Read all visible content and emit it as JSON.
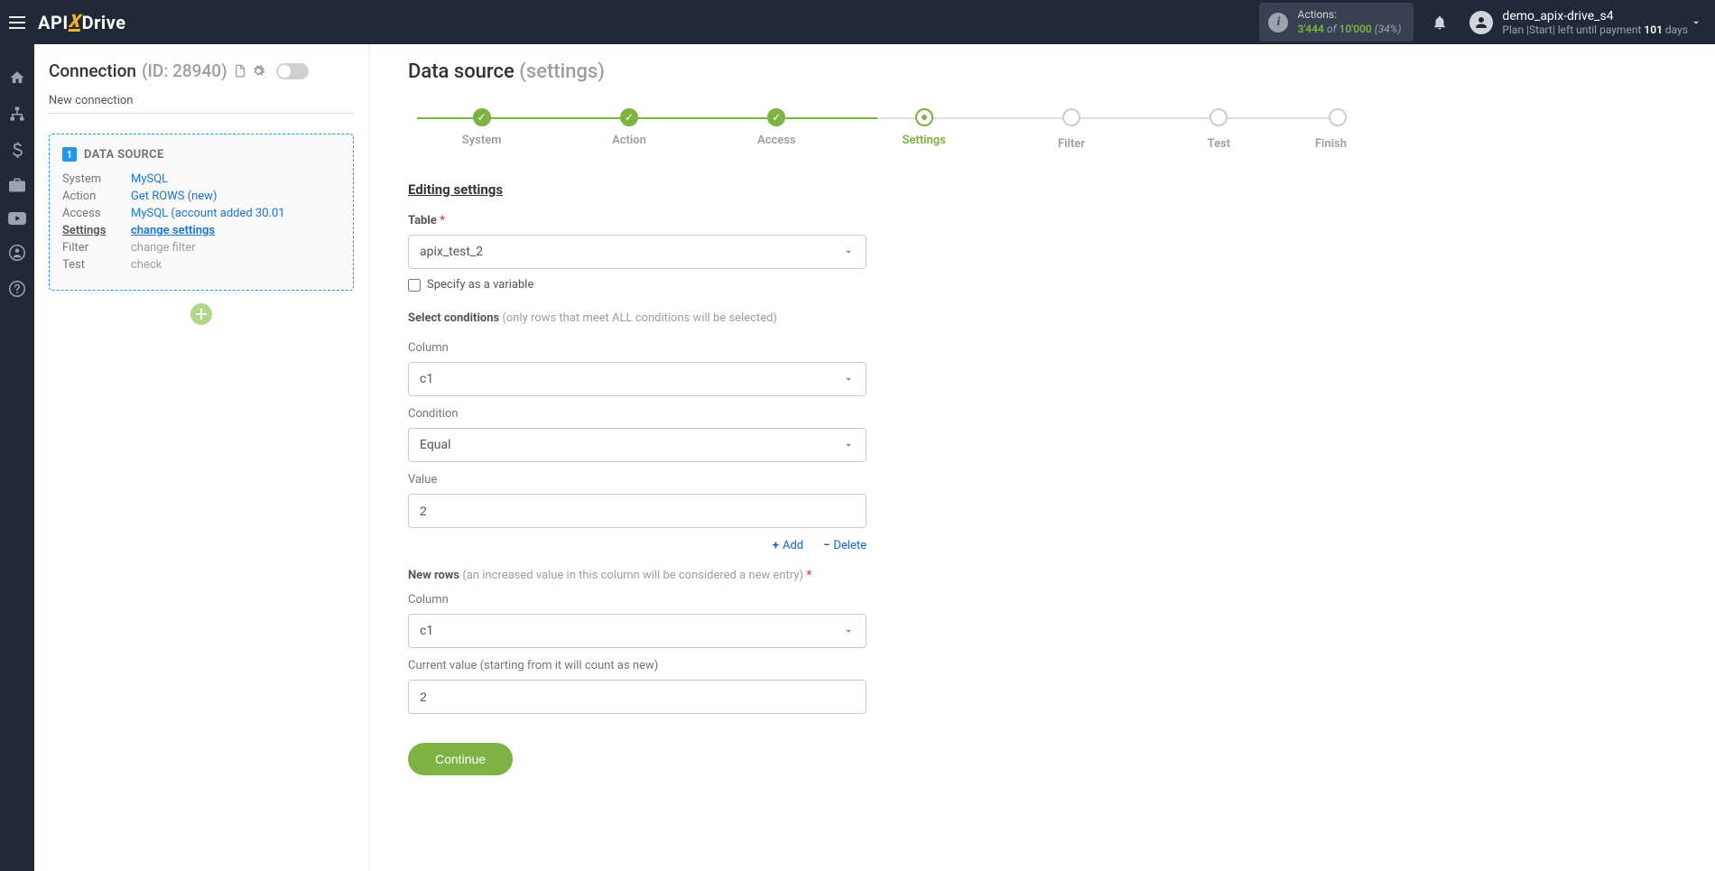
{
  "header": {
    "logo": {
      "part1": "API",
      "x": "X",
      "part2": "Drive"
    },
    "actions": {
      "label": "Actions:",
      "used": "3'444",
      "of": "of",
      "total": "10'000",
      "pct": "(34%)"
    },
    "user": {
      "name": "demo_apix-drive_s4",
      "plan_prefix": "Plan |Start| left until payment ",
      "days": "101",
      "days_suffix": " days"
    }
  },
  "left": {
    "connection_label": "Connection",
    "connection_id": "(ID: 28940)",
    "new_connection": "New connection",
    "ds_title": "DATA SOURCE",
    "ds_badge": "1",
    "rows": {
      "system": {
        "k": "System",
        "v": "MySQL"
      },
      "action": {
        "k": "Action",
        "v": "Get ROWS (new)"
      },
      "access": {
        "k": "Access",
        "v": "MySQL (account added 30.01"
      },
      "settings": {
        "k": "Settings",
        "v": "change settings"
      },
      "filter": {
        "k": "Filter",
        "v": "change filter"
      },
      "test": {
        "k": "Test",
        "v": "check"
      }
    }
  },
  "right": {
    "title": "Data source",
    "title_sub": "(settings)",
    "steps": [
      "System",
      "Action",
      "Access",
      "Settings",
      "Filter",
      "Test",
      "Finish"
    ],
    "section": "Editing settings",
    "form": {
      "table_label": "Table",
      "table_value": "apix_test_2",
      "specify_var": "Specify as a variable",
      "select_cond": "Select conditions",
      "select_cond_hint": "(only rows that meet ALL conditions will be selected)",
      "column_label": "Column",
      "column_value": "c1",
      "condition_label": "Condition",
      "condition_value": "Equal",
      "value_label": "Value",
      "value_value": "2",
      "add": "Add",
      "delete": "Delete",
      "new_rows": "New rows",
      "new_rows_hint": "(an increased value in this column will be considered a new entry)",
      "nr_column_label": "Column",
      "nr_column_value": "c1",
      "current_value_label": "Current value (starting from it will count as new)",
      "current_value_value": "2",
      "continue": "Continue"
    }
  }
}
